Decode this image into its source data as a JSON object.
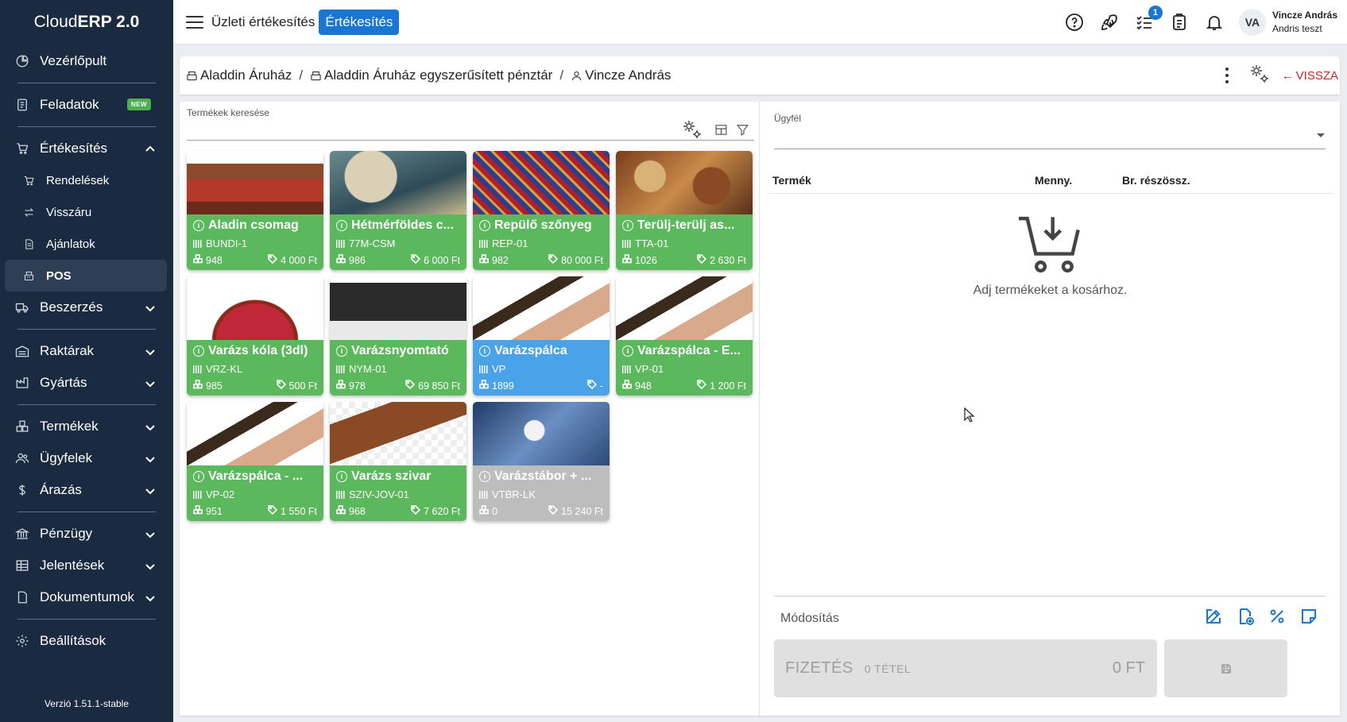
{
  "app": {
    "brand_light": "Cloud",
    "brand_bold": "ERP 2.0",
    "version": "Verzió 1.51.1-stable"
  },
  "sidebar": {
    "items": [
      {
        "label": "Vezérlőpult",
        "icon": "dashboard-icon"
      },
      {
        "label": "Feladatok",
        "icon": "tasks-icon",
        "badge": "NEW"
      },
      {
        "label": "Értékesítés",
        "icon": "cart-icon",
        "expanded": true
      },
      {
        "label": "Rendelések",
        "icon": "cart-icon"
      },
      {
        "label": "Visszáru",
        "icon": "swap-icon"
      },
      {
        "label": "Ajánlatok",
        "icon": "document-icon"
      },
      {
        "label": "POS",
        "icon": "pos-icon",
        "active": true
      },
      {
        "label": "Beszerzés",
        "icon": "truck-icon"
      },
      {
        "label": "Raktárak",
        "icon": "warehouse-icon"
      },
      {
        "label": "Gyártás",
        "icon": "factory-icon"
      },
      {
        "label": "Termékek",
        "icon": "boxes-icon"
      },
      {
        "label": "Ügyfelek",
        "icon": "users-icon"
      },
      {
        "label": "Árazás",
        "icon": "dollar-icon"
      },
      {
        "label": "Pénzügy",
        "icon": "bank-icon"
      },
      {
        "label": "Jelentések",
        "icon": "table-icon"
      },
      {
        "label": "Dokumentumok",
        "icon": "file-icon"
      },
      {
        "label": "Beállítások",
        "icon": "gear-icon"
      }
    ]
  },
  "topbar": {
    "title": "Üzleti értékesítés",
    "pill": "Értékesítés",
    "tasks_count": "1",
    "avatar": "VA",
    "user_name": "Vincze András",
    "user_sub": "Andris teszt"
  },
  "breadcrumb": {
    "store": "Aladdin Áruház",
    "register": "Aladdin Áruház egyszerűsített pénztár",
    "user": "Vincze András",
    "back": "VISSZA"
  },
  "search": {
    "label": "Termékek keresése"
  },
  "products": [
    {
      "name": "Aladin csomag",
      "code": "BUNDI-1",
      "stock": "948",
      "price": "4 000 Ft",
      "color": "green"
    },
    {
      "name": "Hétmérföldes c...",
      "code": "77M-CSM",
      "stock": "986",
      "price": "6 000 Ft",
      "color": "green"
    },
    {
      "name": "Repülő szőnyeg",
      "code": "REP-01",
      "stock": "982",
      "price": "80 000 Ft",
      "color": "green"
    },
    {
      "name": "Terülj-terülj as...",
      "code": "TTA-01",
      "stock": "1026",
      "price": "2 630 Ft",
      "color": "green"
    },
    {
      "name": "Varázs kóla (3dl)",
      "code": "VRZ-KL",
      "stock": "985",
      "price": "500 Ft",
      "color": "green"
    },
    {
      "name": "Varázsnyomtató",
      "code": "NYM-01",
      "stock": "978",
      "price": "69 850 Ft",
      "color": "green"
    },
    {
      "name": "Varázspálca",
      "code": "VP",
      "stock": "1899",
      "price": "-",
      "color": "blue"
    },
    {
      "name": "Varázspálca - E...",
      "code": "VP-01",
      "stock": "948",
      "price": "1 200 Ft",
      "color": "green"
    },
    {
      "name": "Varázspálca - ...",
      "code": "VP-02",
      "stock": "951",
      "price": "1 550 Ft",
      "color": "green"
    },
    {
      "name": "Varázs szivar",
      "code": "SZIV-JOV-01",
      "stock": "968",
      "price": "7 620 Ft",
      "color": "green"
    },
    {
      "name": "Varázstábor + ...",
      "code": "VTBR-LK",
      "stock": "0",
      "price": "15 240 Ft",
      "color": "grey"
    }
  ],
  "cart": {
    "customer_label": "Ügyfél",
    "col_product": "Termék",
    "col_qty": "Menny.",
    "col_subtotal": "Br. részössz.",
    "empty_msg": "Adj termékeket a kosárhoz.",
    "modify_label": "Módosítás",
    "pay_label": "FIZETÉS",
    "pay_items": "0 TÉTEL",
    "pay_total": "0 FT"
  },
  "colors": {
    "sidebar_bg": "#1a2b41",
    "accent": "#1976d2",
    "card_green": "#5cb85c",
    "card_blue": "#4aa3e8",
    "card_grey": "#bdbdbd",
    "back_red": "#c62828"
  }
}
